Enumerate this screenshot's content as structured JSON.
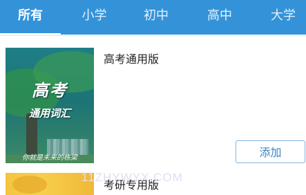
{
  "tabs": [
    {
      "label": "所有",
      "active": true
    },
    {
      "label": "小学",
      "active": false
    },
    {
      "label": "初中",
      "active": false
    },
    {
      "label": "高中",
      "active": false
    },
    {
      "label": "大学",
      "active": false
    }
  ],
  "books": [
    {
      "title": "高考通用版",
      "cover": {
        "line1": "高考",
        "line2": "通用词汇",
        "slogan": "你就是未来的栋梁"
      },
      "action_label": "添加"
    },
    {
      "title": "考研专用版"
    }
  ],
  "watermark": "11ZHYWYX.COM",
  "colors": {
    "tabbar": "#3493d8",
    "button_text": "#3a85c9",
    "button_border": "#7fb3e0"
  }
}
